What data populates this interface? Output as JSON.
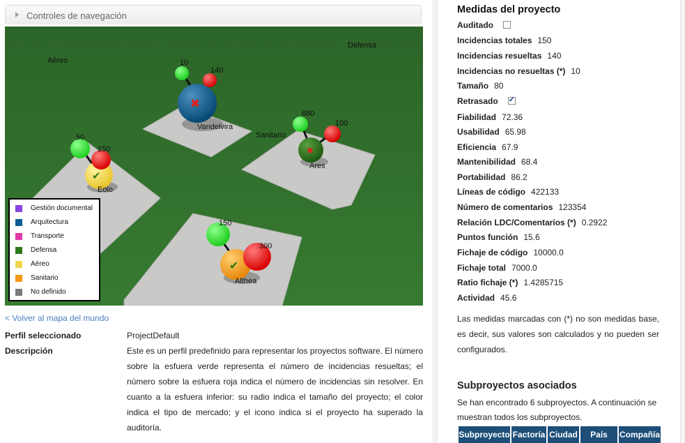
{
  "nav": {
    "title": "Controles de navegación"
  },
  "scene": {
    "zones": [
      {
        "label": "Aéreo"
      },
      {
        "label": "Defensa"
      },
      {
        "label": "Sanitario"
      }
    ],
    "projects": [
      {
        "name": "Vandelvira",
        "type": "Arquitectura",
        "green_count": "10",
        "red_count": "140",
        "audit_icon": "cross-icon"
      },
      {
        "name": "Ares",
        "type": "Defensa",
        "green_count": "680",
        "red_count": "100",
        "audit_icon": "cross-icon"
      },
      {
        "name": "Eolo",
        "type": "Aéreo",
        "green_count": "50",
        "red_count": "150",
        "audit_icon": "check-icon"
      },
      {
        "name": "Althea",
        "type": "Sanitario",
        "green_count": "150",
        "red_count": "300",
        "audit_icon": "check-icon"
      }
    ],
    "legend": [
      {
        "label": "Gestión documental",
        "color": "#8b44e0"
      },
      {
        "label": "Arquitectura",
        "color": "#0b5c8f"
      },
      {
        "label": "Transporte",
        "color": "#e03aa8"
      },
      {
        "label": "Defensa",
        "color": "#2f7a1c"
      },
      {
        "label": "Aéreo",
        "color": "#f0d54a"
      },
      {
        "label": "Sanitario",
        "color": "#f39a16"
      },
      {
        "label": "No definido",
        "color": "#7a7a7a"
      }
    ]
  },
  "back_link": "< Volver al mapa del mundo",
  "profile": {
    "selected_label": "Perfil seleccionado",
    "selected_value": "ProjectDefault",
    "description_label": "Descripción",
    "description_value": "Este es un perfil predefinido para representar los proyectos software. El número sobre la esfuera verde representa el número de incidencias resueltas; el número sobre la esfuera roja indica el número de incidencias sin resolver. En cuanto a la esfuera inferior: su radio indica el tamaño del proyecto; el color indica el tipo de mercado; y el icono indica si el proyecto ha superado la auditoría."
  },
  "measures": {
    "title": "Medidas del proyecto",
    "items": [
      {
        "key": "Auditado",
        "checkbox": true,
        "checked": false
      },
      {
        "key": "Incidencias totales",
        "value": "150"
      },
      {
        "key": "Incidencias resueltas",
        "value": "140"
      },
      {
        "key": "Incidencias no resueltas (*)",
        "value": "10"
      },
      {
        "key": "Tamaño",
        "value": "80"
      },
      {
        "key": "Retrasado",
        "checkbox": true,
        "checked": true
      },
      {
        "key": "Fiabilidad",
        "value": "72.36"
      },
      {
        "key": "Usabilidad",
        "value": "65.98"
      },
      {
        "key": "Eficiencia",
        "value": "67.9"
      },
      {
        "key": "Mantenibilidad",
        "value": "68.4"
      },
      {
        "key": "Portabilidad",
        "value": "86.2"
      },
      {
        "key": "Líneas de código",
        "value": "422133"
      },
      {
        "key": "Número de comentarios",
        "value": "123354"
      },
      {
        "key": "Relación LDC/Comentarios (*)",
        "value": "0.2922"
      },
      {
        "key": "Puntos función",
        "value": "15.6"
      },
      {
        "key": "Fichaje de código",
        "value": "10000.0"
      },
      {
        "key": "Fichaje total",
        "value": "7000.0"
      },
      {
        "key": "Ratio fichaje (*)",
        "value": "1.4285715"
      },
      {
        "key": "Actividad",
        "value": "45.6"
      }
    ],
    "note": "Las medidas marcadas con (*) no son medidas base, es decir, sus valores son calculados y no pueden ser configurados."
  },
  "subprojects": {
    "title": "Subproyectos asociados",
    "text": "Se han encontrado 6 subproyectos. A continuación se muestran todos los subproyectos.",
    "columns": [
      "Subproyecto",
      "Factoría",
      "Ciudad",
      "País",
      "Compañía"
    ]
  }
}
